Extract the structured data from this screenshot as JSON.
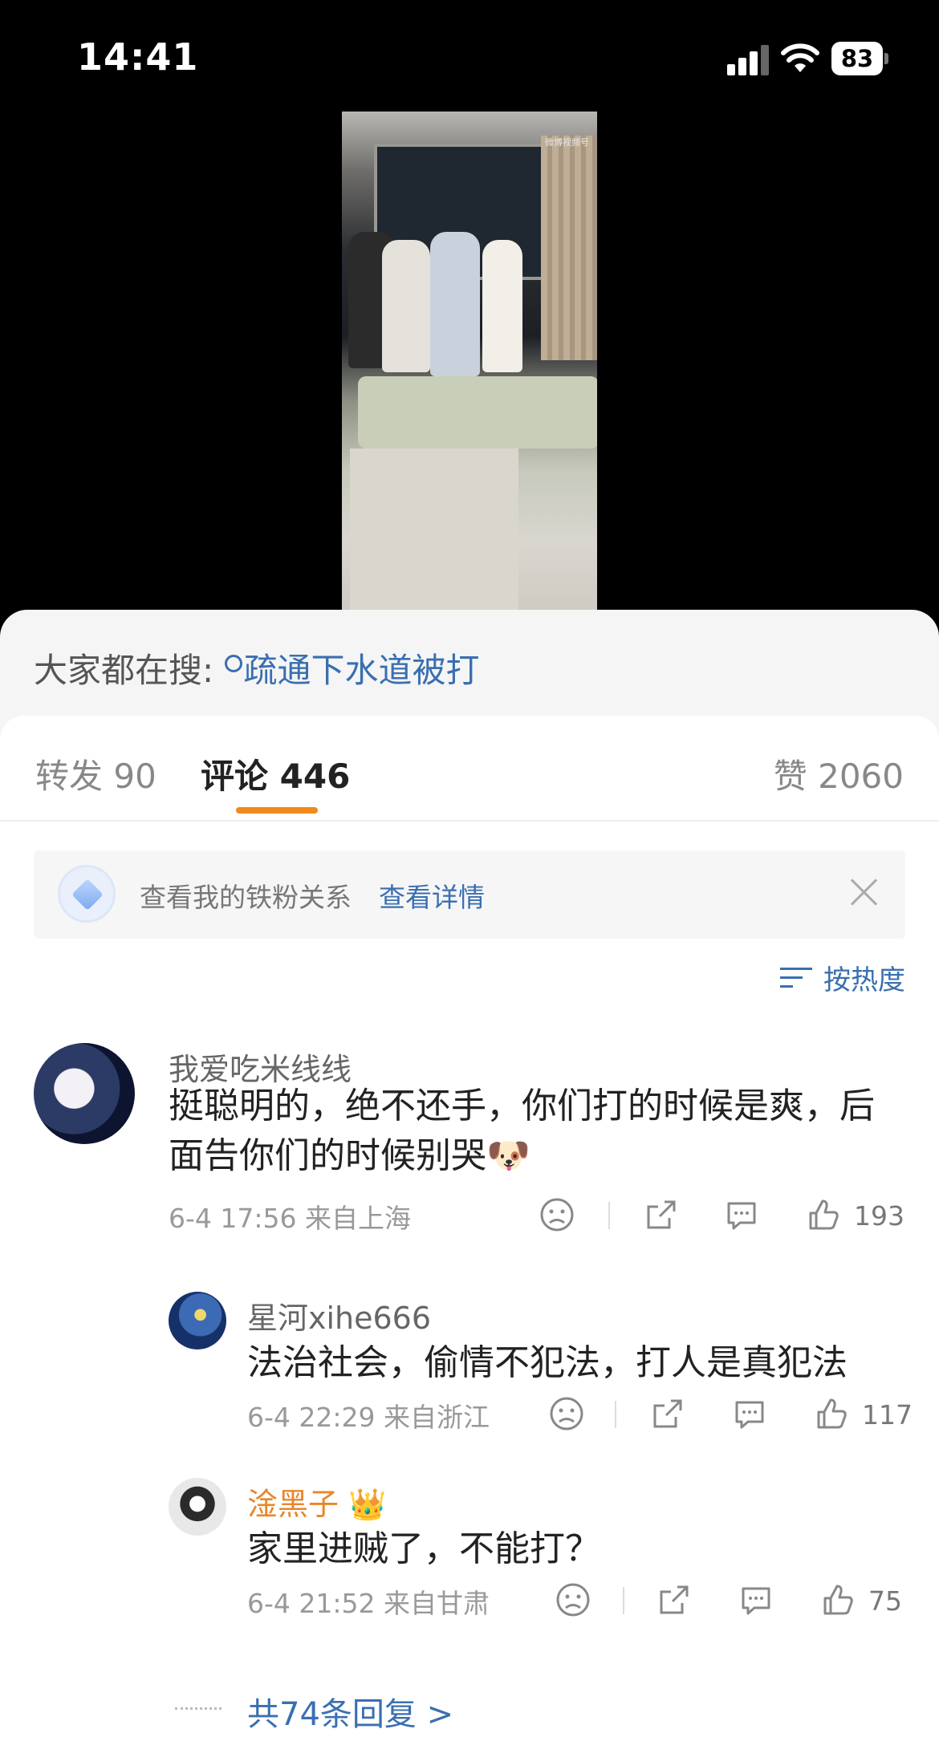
{
  "status_bar": {
    "time": "14:41",
    "battery": "83"
  },
  "video": {
    "watermark": "微博视频号"
  },
  "hot_search": {
    "prefix": "大家都在搜: ",
    "keyword": "疏通下水道被打"
  },
  "tabs": {
    "repost_label": "转发",
    "repost_count": "90",
    "comment_label": "评论",
    "comment_count": "446",
    "like_label": "赞",
    "like_count": "2060"
  },
  "fan_banner": {
    "text": "查看我的铁粉关系",
    "link": "查看详情"
  },
  "sort": {
    "label": "按热度"
  },
  "comments": [
    {
      "username": "我爱吃米线线",
      "text": "挺聪明的，绝不还手，你们打的时候是爽，后面告你们的时候别哭",
      "emoji": "🐶",
      "time": "6-4 17:56",
      "location": "来自上海",
      "likes": "193"
    }
  ],
  "replies": [
    {
      "username": "星河xihe666",
      "text": "法治社会，偷情不犯法，打人是真犯法",
      "time": "6-4 22:29",
      "location": "来自浙江",
      "likes": "117"
    },
    {
      "username": "淦黑子",
      "badge": "👑",
      "text": "家里进贼了，不能打？",
      "time": "6-4 21:52",
      "location": "来自甘肃",
      "likes": "75"
    }
  ],
  "more_replies": "共74条回复 >",
  "colors": {
    "accent": "#f08a1c",
    "link": "#3a6fb0",
    "vip": "#e8862a"
  }
}
